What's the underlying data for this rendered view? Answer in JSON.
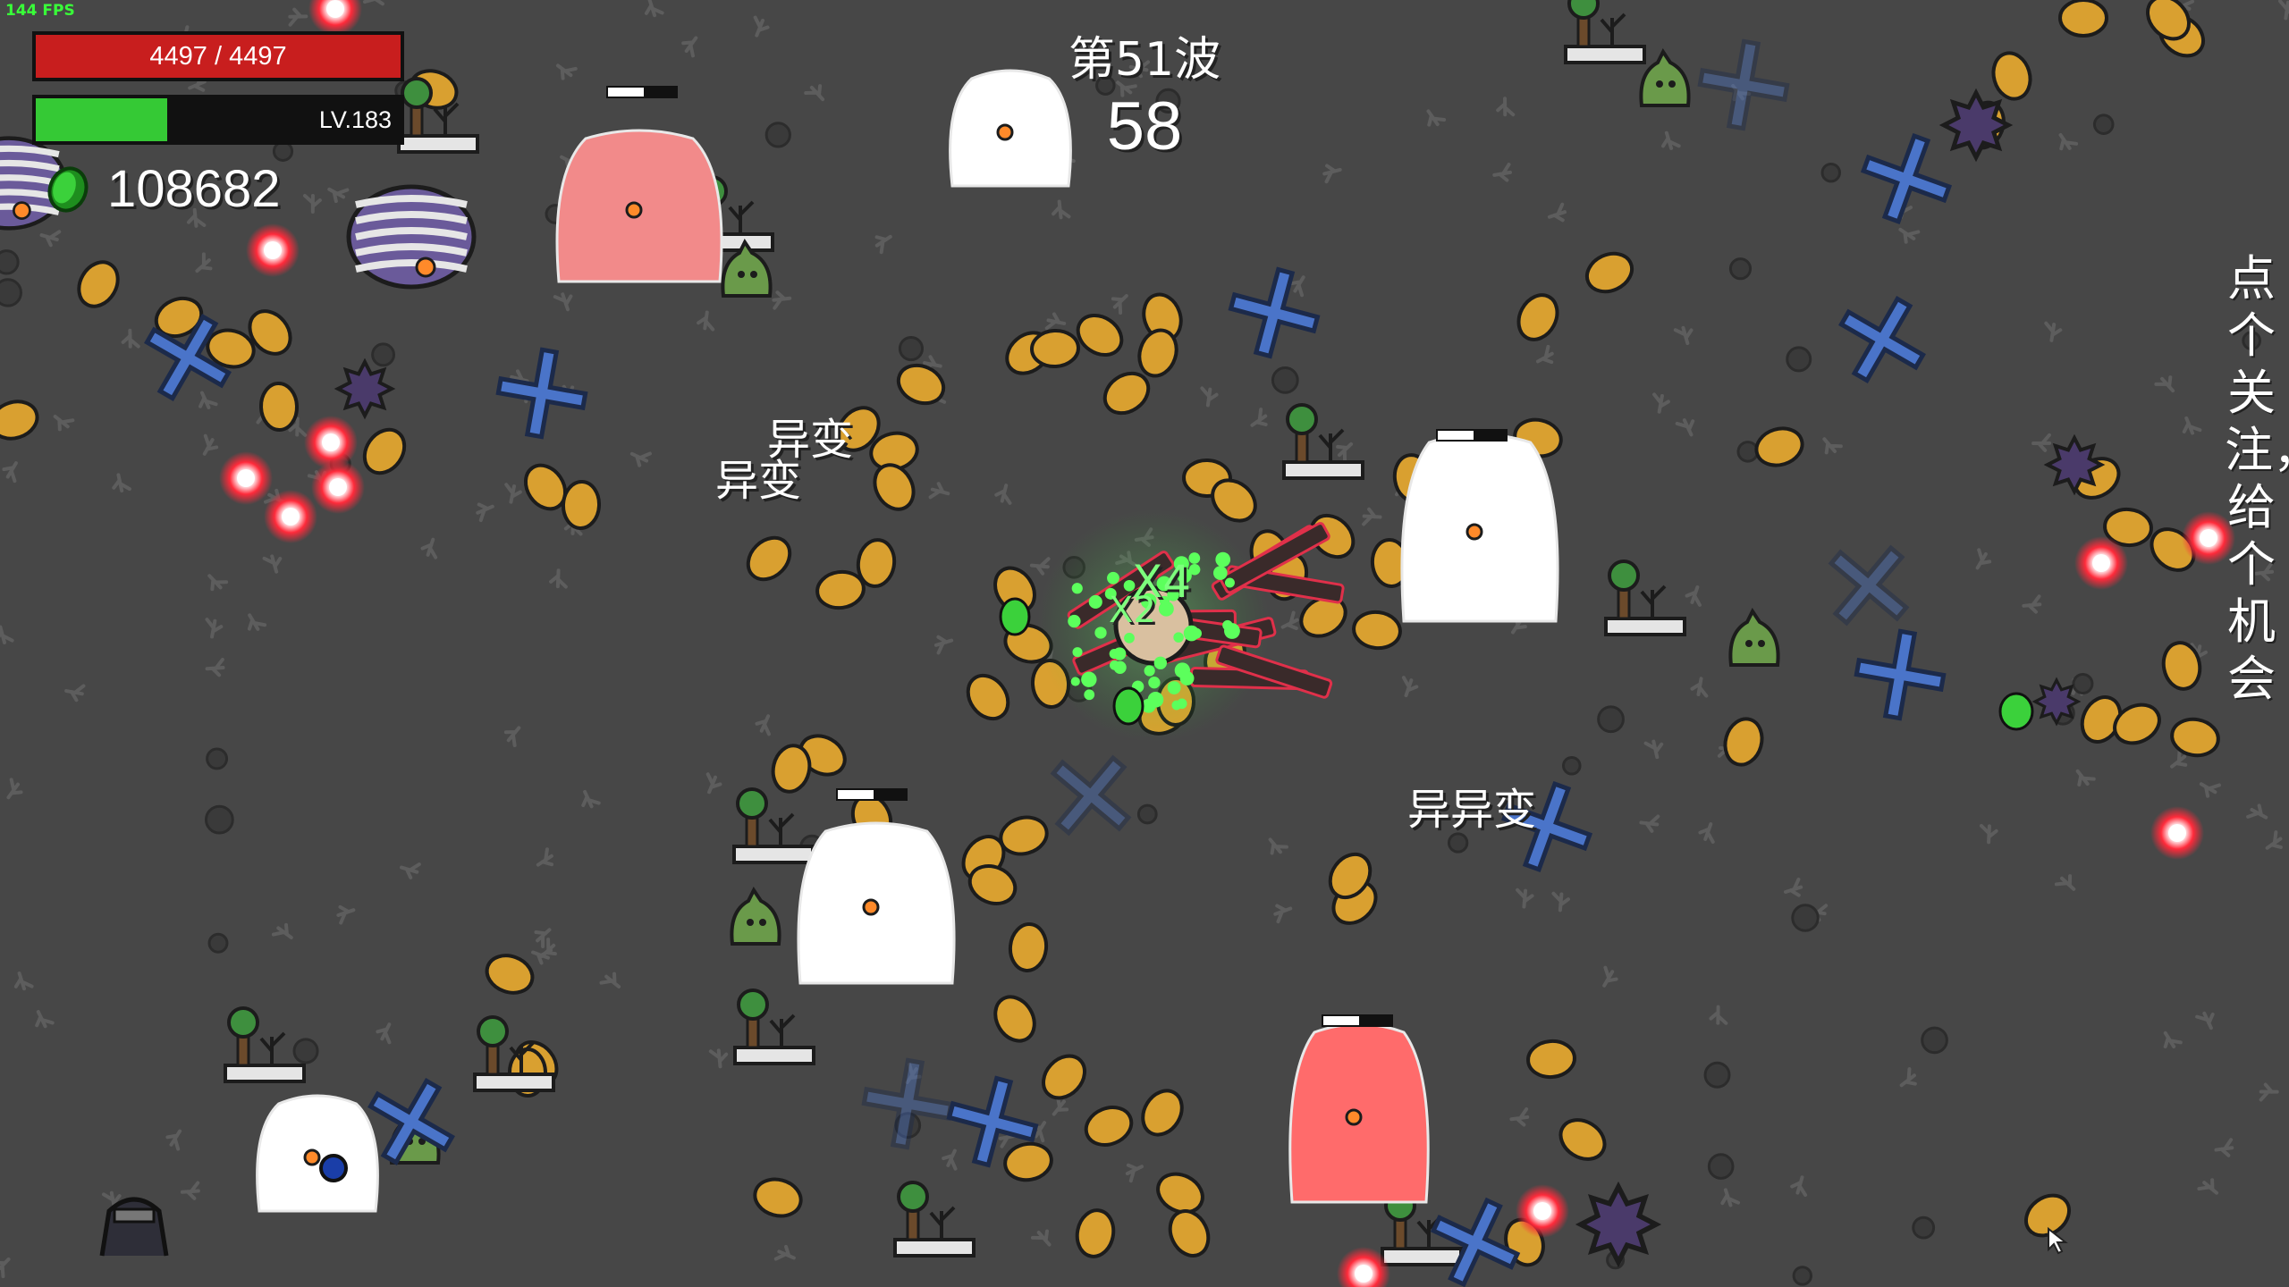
{
  "hud": {
    "fps": "144 FPS",
    "hp_text": "4497 / 4497",
    "hp_fraction": 1.0,
    "level_text": "LV.183",
    "xp_fraction": 0.36,
    "materials": "108682",
    "wave_label": "第51波",
    "wave_timer": "58"
  },
  "floating_text": {
    "mutation_1": "异变",
    "mutation_2": "异变",
    "mutation_3": "异异变",
    "multiplier_x4": "X4",
    "multiplier_x2": "X2"
  },
  "overlay_caption": "点个关注，给个机会",
  "colors": {
    "background": "#474747",
    "hp": "#c81e1e",
    "xp": "#35c935",
    "material": "#d9a030",
    "enemy_bullet": "#ff2a3a",
    "blue_cross": "#4a74c9",
    "pink_enemy": "#ff6b6b"
  },
  "icons": {
    "material": "material-potato-icon",
    "coin": "green-material-coin-icon",
    "cursor": "mouse-cursor-icon",
    "turret": "turret-icon",
    "tree": "tree-icon"
  }
}
